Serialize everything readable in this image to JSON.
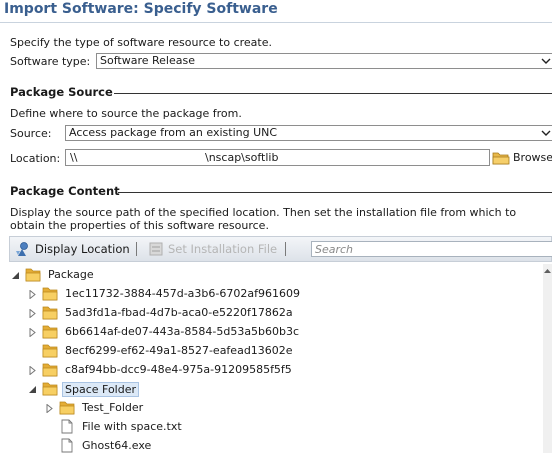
{
  "window": {
    "title": "Import Software: Specify Software"
  },
  "software_type": {
    "instruction": "Specify the type of software resource to create.",
    "label": "Software type:",
    "selected": "Software Release"
  },
  "package_source": {
    "heading": "Package Source",
    "instruction": "Define where to source the package from.",
    "source_label": "Source:",
    "source_selected": "Access package from an existing UNC",
    "location_label": "Location:",
    "location_prefix": "\\\\",
    "location_suffix": "\\nscap\\softlib",
    "browse_label": "Browse"
  },
  "package_content": {
    "heading": "Package Content",
    "instruction_line1": "Display the source path of the specified location. Then set the installation file from which to",
    "instruction_line2": "obtain the properties of this software resource.",
    "toolbar": {
      "display_location": "Display Location",
      "set_installation_file": "Set Installation File",
      "search_placeholder": "Search"
    },
    "tree": [
      {
        "label": "Package",
        "type": "folder",
        "depth": 0,
        "expander": "expanded"
      },
      {
        "label": "1ec11732-3884-457d-a3b6-6702af961609",
        "type": "folder",
        "depth": 1,
        "expander": "collapsed"
      },
      {
        "label": "5ad3fd1a-fbad-4d7b-aca0-e5220f17862a",
        "type": "folder",
        "depth": 1,
        "expander": "collapsed"
      },
      {
        "label": "6b6614af-de07-443a-8584-5d53a5b60b3c",
        "type": "folder",
        "depth": 1,
        "expander": "collapsed"
      },
      {
        "label": "8ecf6299-ef62-49a1-8527-eafead13602e",
        "type": "folder",
        "depth": 1,
        "expander": "none"
      },
      {
        "label": "c8af94bb-dcc9-48e4-975a-91209585f5f5",
        "type": "folder",
        "depth": 1,
        "expander": "collapsed"
      },
      {
        "label": "Space Folder",
        "type": "folder",
        "depth": 1,
        "expander": "expanded",
        "selected": true
      },
      {
        "label": "Test_Folder",
        "type": "folder",
        "depth": 2,
        "expander": "collapsed"
      },
      {
        "label": "File with space.txt",
        "type": "file",
        "depth": 2,
        "expander": "none"
      },
      {
        "label": "Ghost64.exe",
        "type": "file",
        "depth": 2,
        "expander": "none"
      }
    ]
  }
}
